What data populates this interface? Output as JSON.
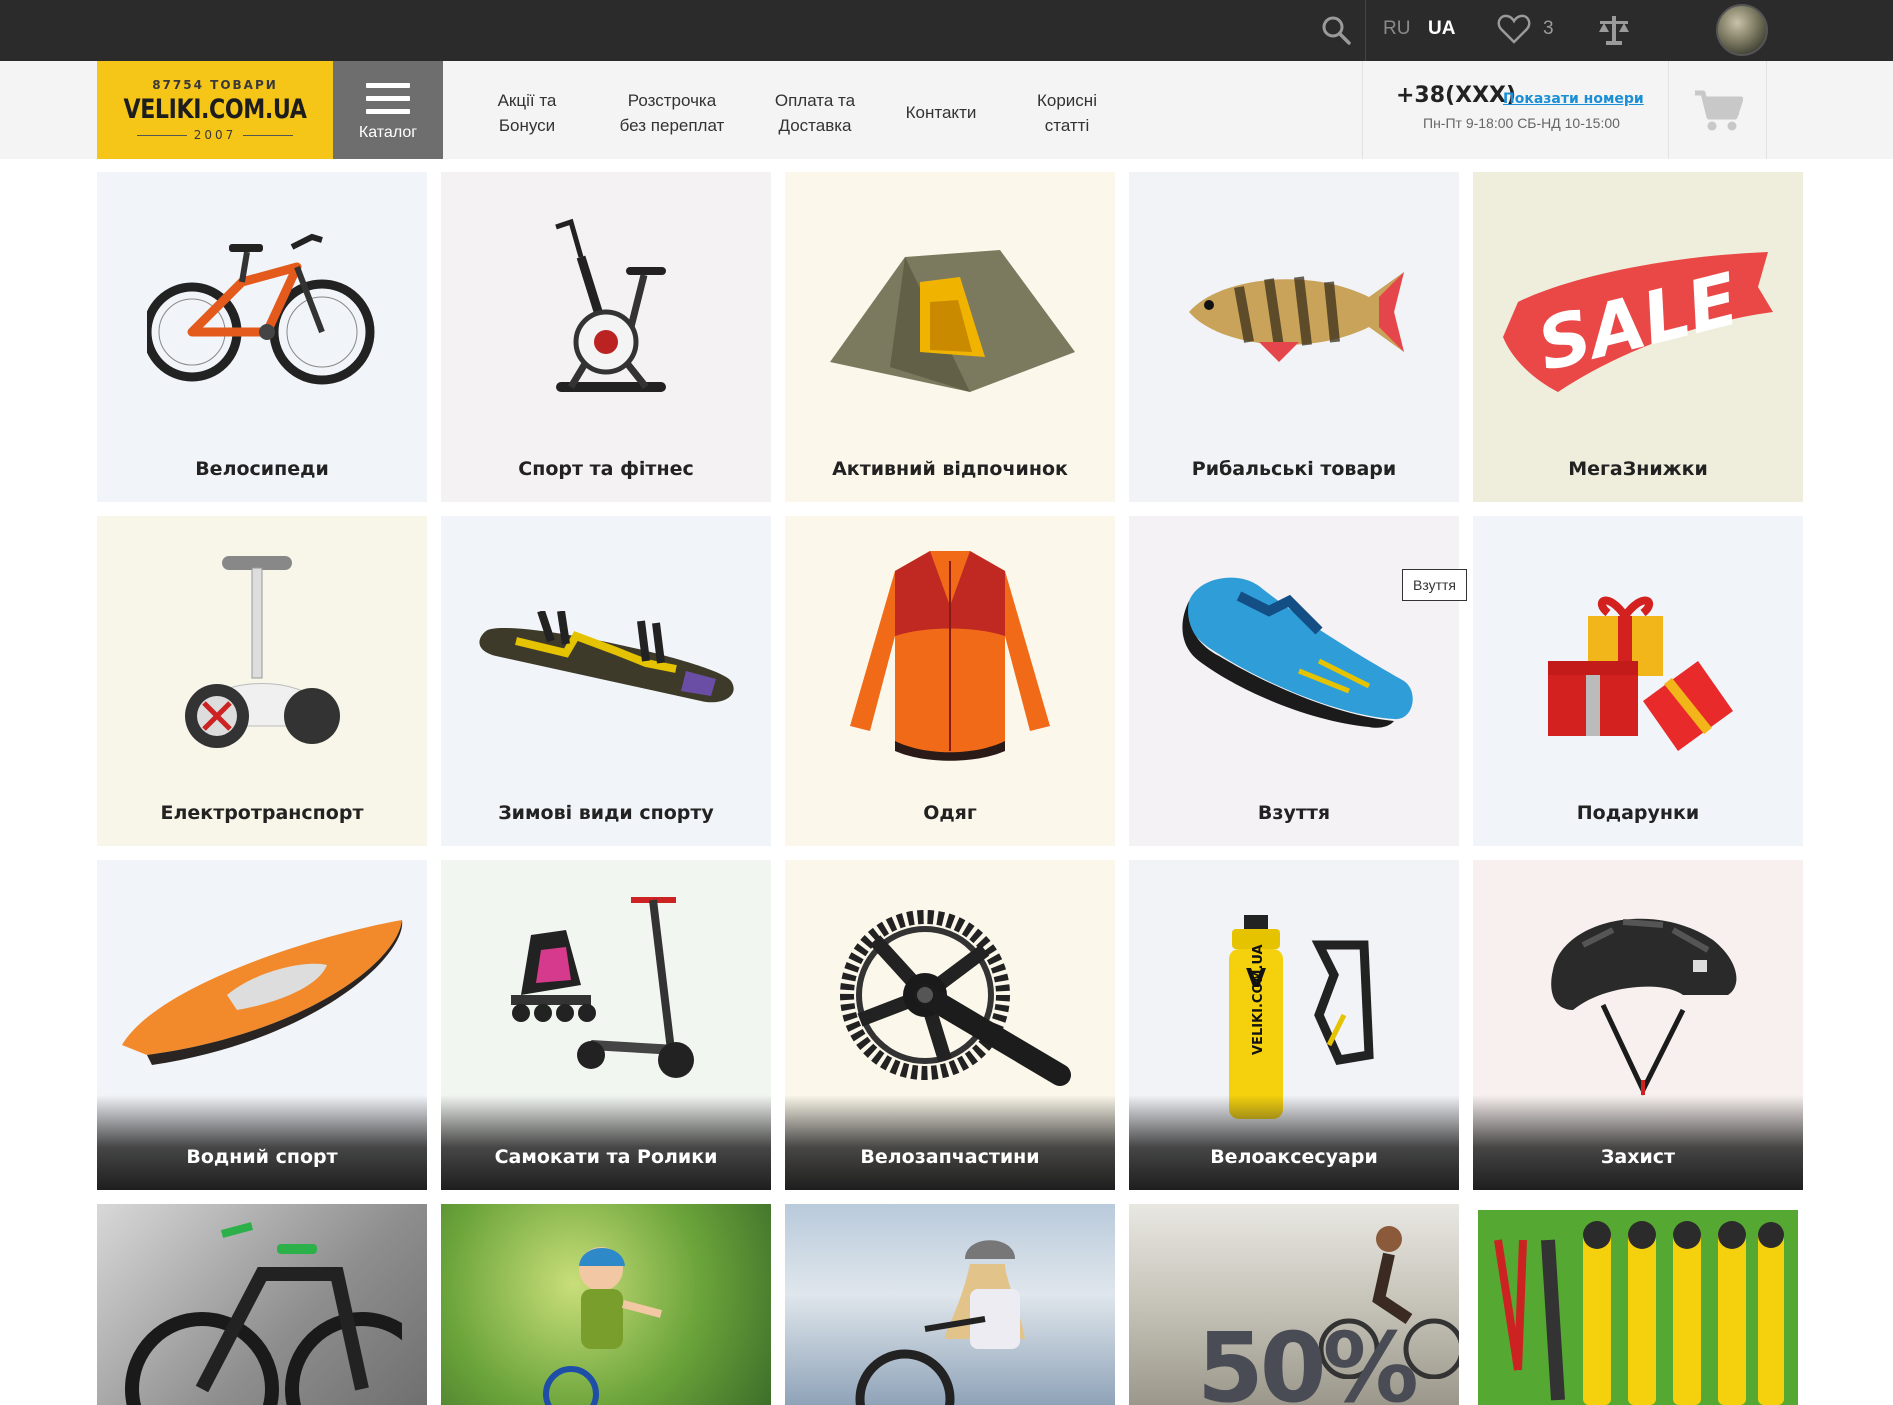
{
  "topbar": {
    "lang_ru": "RU",
    "lang_ua": "UA",
    "favorites_count": "3"
  },
  "header": {
    "logo_count": "87754 ТОВАРИ",
    "logo_brand": "VELIKI.COM.UA",
    "logo_year": "2007",
    "catalog_label": "Каталог",
    "nav": [
      {
        "line1": "Акції та",
        "line2": "Бонуси"
      },
      {
        "line1": "Розстрочка",
        "line2": "без переплат"
      },
      {
        "line1": "Оплата та",
        "line2": "Доставка"
      },
      {
        "line1": "Контакти",
        "line2": ""
      },
      {
        "line1": "Корисні",
        "line2": "статті"
      }
    ],
    "phone": "+38(XXX)",
    "show_numbers": "Показати номери",
    "hours": "Пн-Пт 9-18:00 СБ-НД 10-15:00"
  },
  "categories": [
    {
      "label": "Велосипеди"
    },
    {
      "label": "Спорт та фітнес"
    },
    {
      "label": "Активний відпочинок"
    },
    {
      "label": "Рибальські товари"
    },
    {
      "label": "МегаЗнижки"
    },
    {
      "label": "Електротранспорт"
    },
    {
      "label": "Зимові види спорту"
    },
    {
      "label": "Одяг"
    },
    {
      "label": "Взуття"
    },
    {
      "label": "Подарунки"
    },
    {
      "label": "Водний спорт"
    },
    {
      "label": "Самокати та Ролики"
    },
    {
      "label": "Велозапчастини"
    },
    {
      "label": "Велоаксесуари"
    },
    {
      "label": "Захист"
    }
  ],
  "tile_texts": {
    "sale_art": "SALE",
    "shoes_badge": "Взуття",
    "bottle_letter": "V",
    "bottle_text": "VELIKI.COM.UA",
    "promo_percent": "50%"
  },
  "colors": {
    "topbar_bg": "#2b2b2b",
    "logo_yellow": "#f5c518",
    "catalog_gray": "#6e6e6e",
    "link_blue": "#1a8fd6"
  }
}
